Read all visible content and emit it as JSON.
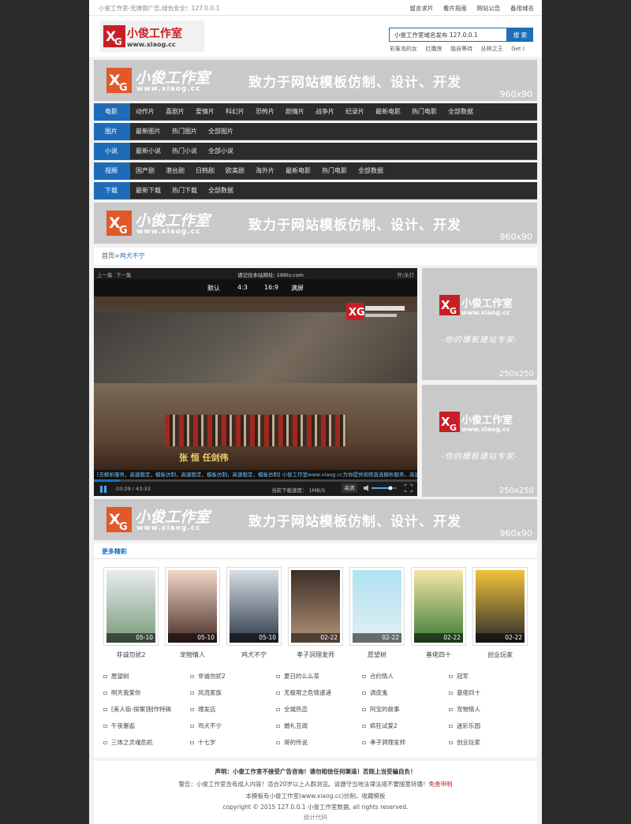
{
  "topbar": {
    "site_text": "小俊工作室-无弹窗广告,绿色安全！127.0.0.1",
    "links": [
      "留言求片",
      "看片指南",
      "网站公告",
      "备用域名"
    ]
  },
  "header": {
    "logo_title": "小俊工作室",
    "logo_url": "www.xiaog.cc",
    "search_value": "小俊工作室域名发布 127.0.0.1",
    "search_button": "搜 索",
    "hot_words": [
      "彩象岛的女",
      "红鹰侠",
      "独自等待",
      "丛林之王",
      "Get I"
    ]
  },
  "banner": {
    "title": "小俊工作室",
    "url": "www.xiaog.cc",
    "slogan": "致力于网站模板仿制、设计、开发",
    "size": "960x90"
  },
  "nav": [
    {
      "cat": "电影",
      "items": [
        "动作片",
        "喜剧片",
        "爱情片",
        "科幻片",
        "恐怖片",
        "剧情片",
        "战争片",
        "纪录片",
        "最新电影",
        "热门电影",
        "全部数据"
      ]
    },
    {
      "cat": "图片",
      "items": [
        "最新图片",
        "热门图片",
        "全部图片"
      ]
    },
    {
      "cat": "小说",
      "items": [
        "最新小说",
        "热门小说",
        "全部小说"
      ]
    },
    {
      "cat": "视频",
      "items": [
        "国产剧",
        "港台剧",
        "日韩剧",
        "欧美剧",
        "海外片",
        "最新电影",
        "热门电影",
        "全部数据"
      ]
    },
    {
      "cat": "下载",
      "items": [
        "最新下载",
        "热门下载",
        "全部数据"
      ]
    }
  ],
  "crumbs": {
    "home": "首页",
    "sep": ">",
    "current": "鸡犬不宁"
  },
  "player": {
    "prev": "上一集",
    "next": "下一集",
    "notice": "请记住本站网址: 199tv.com",
    "lights": "开/关灯",
    "modes": [
      "默认",
      "4:3",
      "16:9",
      "满屏"
    ],
    "subtitle": "张  恒  任剑伟",
    "ticker": "[去解析服务，高速稳定，模板仿制，高速稳定，模板仿制，高速稳定，模板仿制] 小俊工作室www.xiaog.cc为你提供视频直连解析服务，高速稳定，模板仿制整合！",
    "time": "03:29  /  43:33",
    "progress": 0.08,
    "speed": "当前下载速度：  1MB/S",
    "quality": "高清",
    "volume": 0.75
  },
  "side_ad": {
    "title": "小俊工作室",
    "url": "www.xiaog.cc",
    "slogan": "-你的模板建站专家-",
    "size": "250x250"
  },
  "more": {
    "title": "更多精彩",
    "posters": [
      {
        "title": "非诚勿扰2",
        "date": "05-10",
        "c1": "#e9ecef",
        "c2": "#7a9a7a"
      },
      {
        "title": "宠物情人",
        "date": "05-10",
        "c1": "#f1d6c8",
        "c2": "#4a2f2a"
      },
      {
        "title": "鸡犬不宁",
        "date": "05-10",
        "c1": "#d7dee6",
        "c2": "#2e3b48"
      },
      {
        "title": "孝子洞理发师",
        "date": "02-22",
        "c1": "#3a2e26",
        "c2": "#b39378"
      },
      {
        "title": "愿望树",
        "date": "02-22",
        "c1": "#aee3f2",
        "c2": "#e4eef2"
      },
      {
        "title": "基佬四十",
        "date": "02-22",
        "c1": "#f6e6a8",
        "c2": "#3d7c3a"
      },
      {
        "title": "创业玩家",
        "date": "02-22",
        "c1": "#f2c23a",
        "c2": "#2a2a2a"
      }
    ],
    "list": [
      [
        "愿望树",
        "非诚勿扰2",
        "夏日的么么茶",
        "合约情人",
        "冠军"
      ],
      [
        "明天我爱你",
        "风流家族",
        "无极限之危情速递",
        "调皮鬼",
        "基佬四十"
      ],
      [
        "[美人街-探案]制作特辑",
        "理发店",
        "全城热恋",
        "阿宝的故事",
        "宠物情人"
      ],
      [
        "午夜邂逅",
        "鸡犬不宁",
        "婚礼丑闻",
        "疯狂试爱2",
        "迷彩乐园"
      ],
      [
        "三体之灵魂危机",
        "十七岁",
        "哥的传说",
        "孝子洞理发师",
        "创业玩家"
      ]
    ]
  },
  "footer": {
    "line1": "声明：小俊工作室不接受广告咨询！请勿相信任何渠道！否则上当受骗自负！",
    "line2": "警告：小俊工作室含有成人内容！适合20岁以上人群浏览。请遵守当地法律法规不要随意转播！",
    "line2_red": "免责申明",
    "line3": "本模板有小俊工作室(www.xiaog.cc)仿制，收藏模板",
    "line4": "copyright © 2015 127.0.0.1 小俊工作室数据, all rights reserved.",
    "line5": "统计代码"
  },
  "colors": {
    "accent": "#1e6cb8",
    "brand_red": "#c81f27",
    "banner_bg": "#c9c9c9",
    "nav_bg": "#2c2c2c"
  }
}
